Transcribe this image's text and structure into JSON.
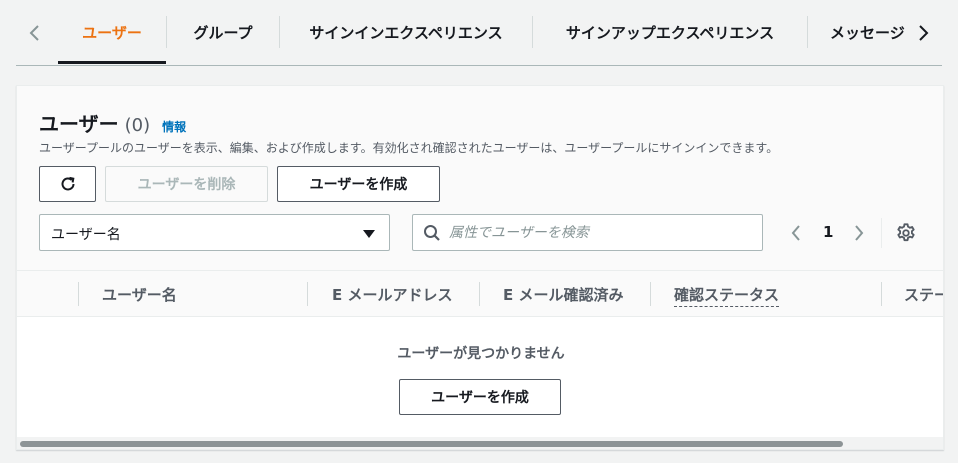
{
  "tabs": [
    {
      "label": "ユーザー",
      "active": true
    },
    {
      "label": "グループ",
      "active": false
    },
    {
      "label": "サインインエクスペリエンス",
      "active": false
    },
    {
      "label": "サインアップエクスペリエンス",
      "active": false
    },
    {
      "label": "メッセージ",
      "active": false
    }
  ],
  "header": {
    "title": "ユーザー",
    "count": "(0)",
    "info_link": "情報",
    "description": "ユーザープールのユーザーを表示、編集、および作成します。有効化され確認されたユーザーは、ユーザープールにサインインできます。"
  },
  "toolbar": {
    "refresh_icon": "refresh-icon",
    "delete_label": "ユーザーを削除",
    "create_label": "ユーザーを作成"
  },
  "filter": {
    "property_selected": "ユーザー名",
    "search_placeholder": "属性でユーザーを検索"
  },
  "pagination": {
    "current_page": "1"
  },
  "table": {
    "columns": [
      "ユーザー名",
      "E メールアドレス",
      "E メール確認済み",
      "確認ステータス",
      "ステータス"
    ]
  },
  "empty_state": {
    "message": "ユーザーが見つかりません",
    "create_label": "ユーザーを作成"
  },
  "colors": {
    "accent": "#ec7211",
    "link": "#0073bb",
    "text": "#16191f",
    "secondary_text": "#545b64"
  }
}
